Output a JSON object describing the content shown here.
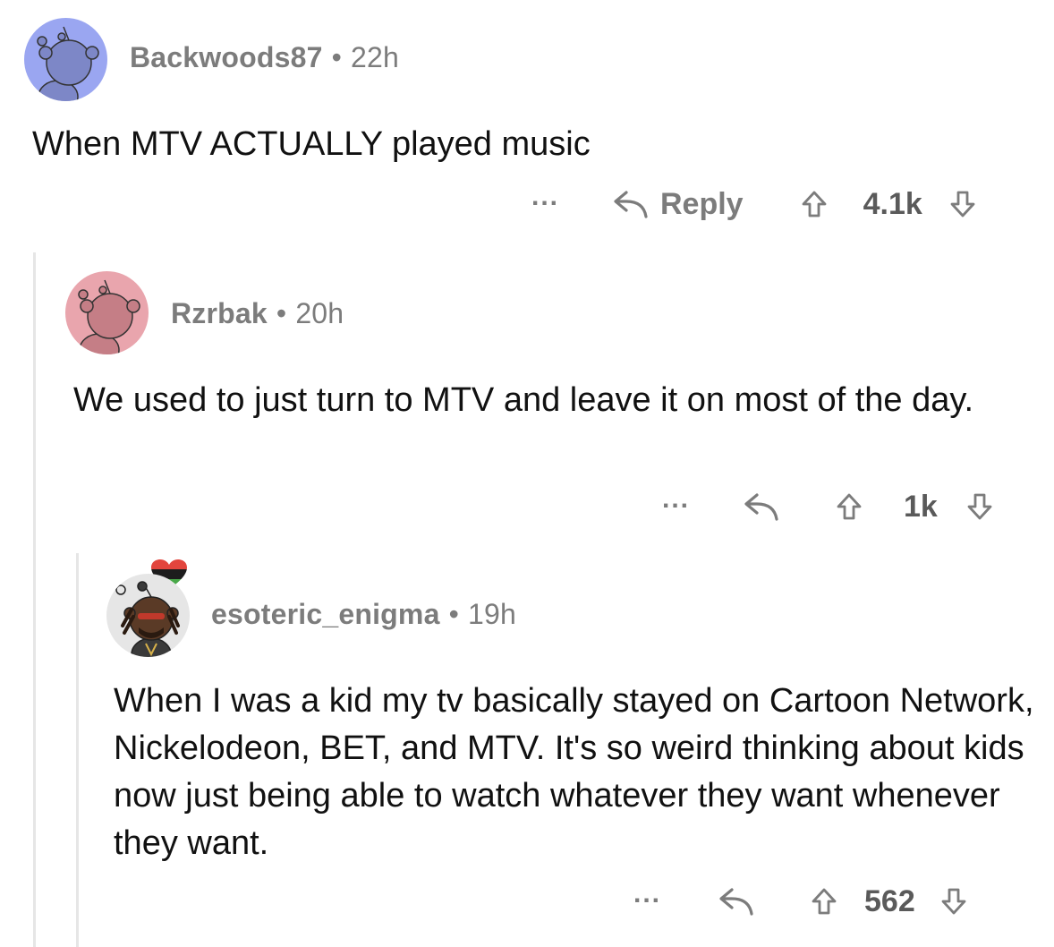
{
  "comments": [
    {
      "username": "Backwoods87",
      "separator": "•",
      "time": "22h",
      "body": "When MTV ACTUALLY played music",
      "more_label": "...",
      "reply_label": "Reply",
      "score": "4.1k",
      "avatar_color": "#9aa6f1"
    },
    {
      "username": "Rzrbak",
      "separator": "•",
      "time": "20h",
      "body": "We used to just turn to MTV and leave it on most of the day.",
      "more_label": "...",
      "score": "1k",
      "avatar_color": "#e9a5ad"
    },
    {
      "username": "esoteric_enigma",
      "separator": "•",
      "time": "19h",
      "body": "When I was a kid my tv basically stayed on Cartoon Network, Nickelodeon, BET, and MTV. It's so weird thinking about kids now just being able to watch whatever they want whenever they want.",
      "more_label": "...",
      "score": "562",
      "avatar_color": "#e6e6e6"
    }
  ],
  "icons": {
    "reply": "reply-arrow-icon",
    "upvote": "upvote-arrow-icon",
    "downvote": "downvote-arrow-icon",
    "more": "more-dots-icon",
    "flair": "heart-flair-icon"
  },
  "colors": {
    "meta_text": "#7c7c7c",
    "body_text": "#111111",
    "thread_line": "#e6e6e6"
  }
}
